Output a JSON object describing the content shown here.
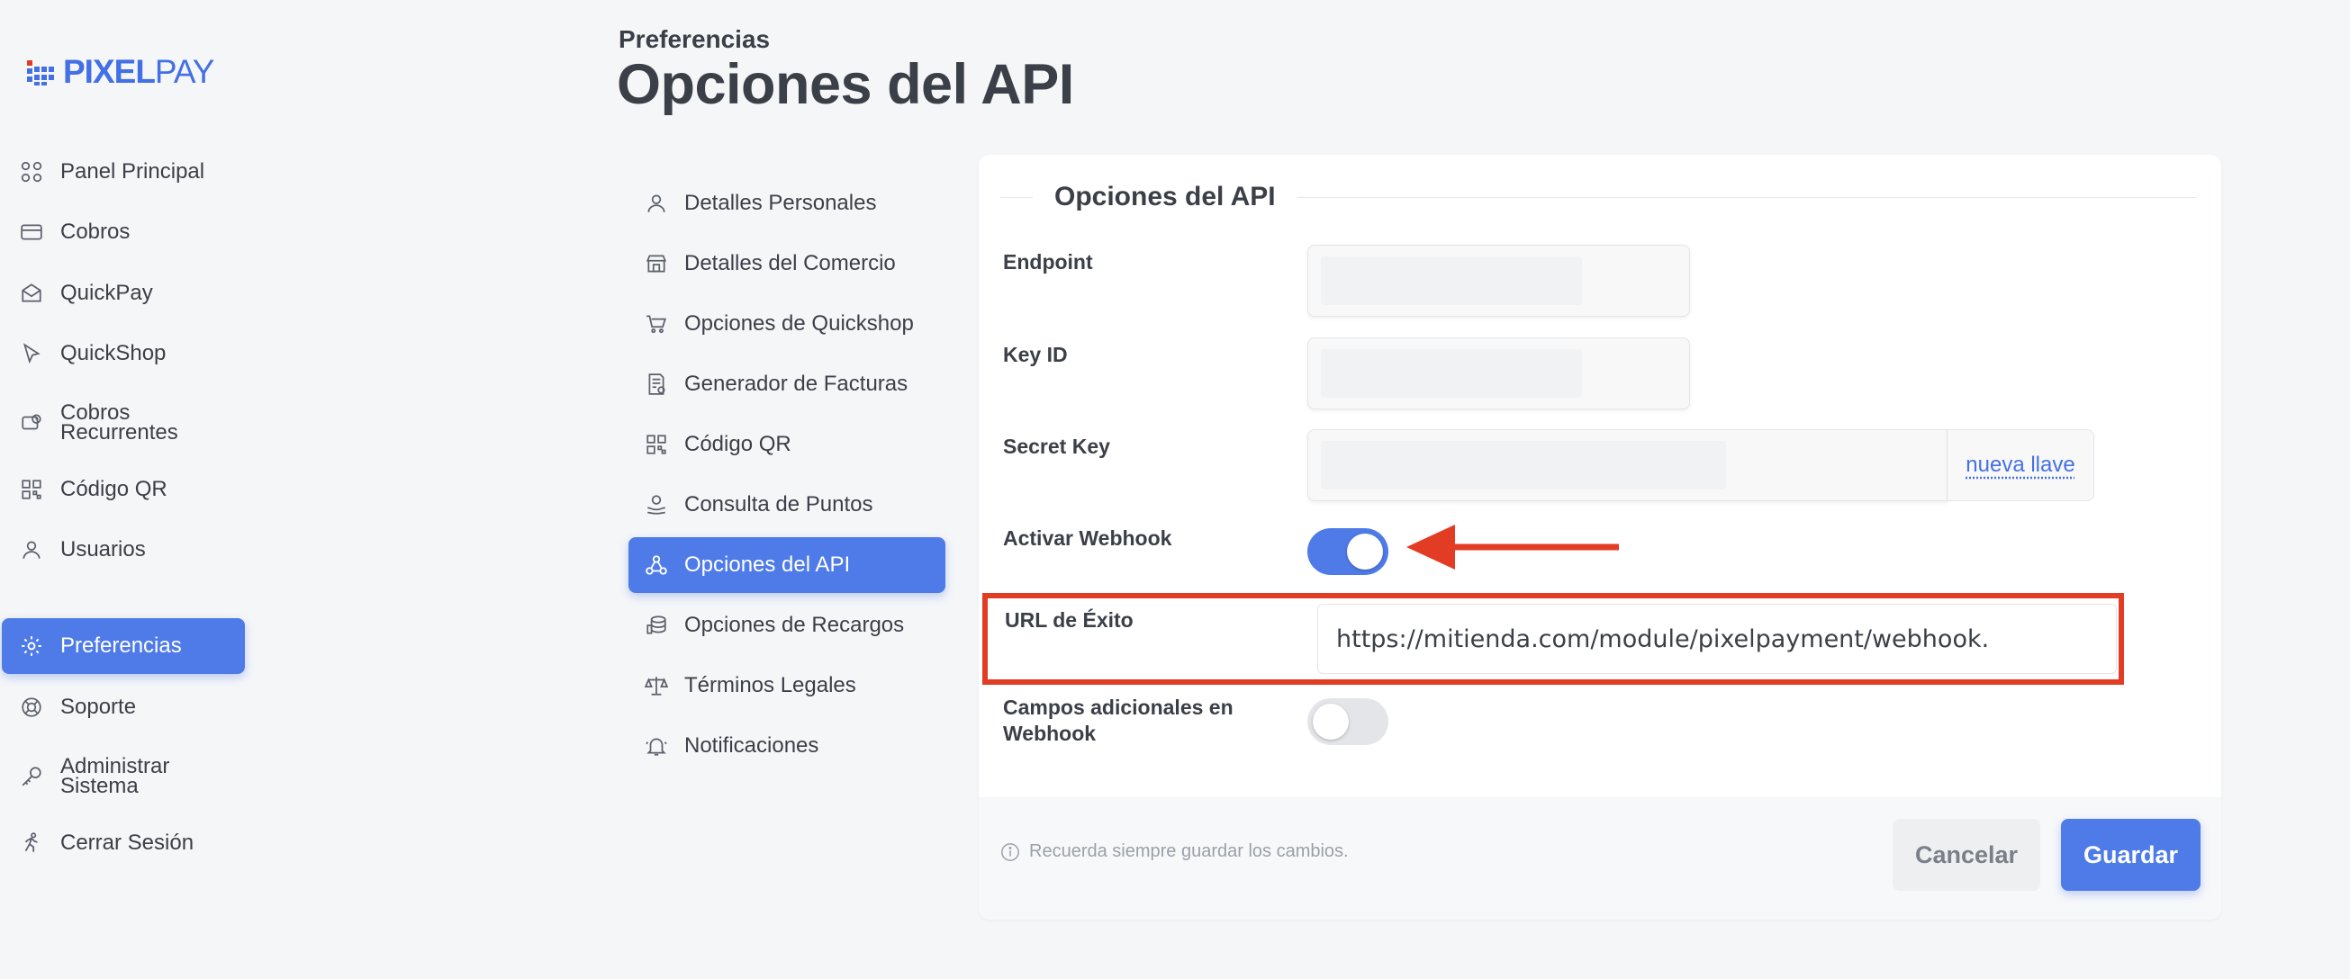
{
  "brand": {
    "name_bold": "PIXEL",
    "name_light": "PAY",
    "color": "#4470e6"
  },
  "sidebar": {
    "items": [
      {
        "label": "Panel Principal",
        "icon": "grid-icon"
      },
      {
        "label": "Cobros",
        "icon": "credit-card-icon"
      },
      {
        "label": "QuickPay",
        "icon": "envelope-icon"
      },
      {
        "label": "QuickShop",
        "icon": "cursor-icon"
      },
      {
        "label": "Cobros Recurrentes",
        "icon": "recurring-icon"
      },
      {
        "label": "Código QR",
        "icon": "qr-code-icon"
      },
      {
        "label": "Usuarios",
        "icon": "user-icon"
      },
      {
        "label": "Preferencias",
        "icon": "gear-icon",
        "active": true
      },
      {
        "label": "Soporte",
        "icon": "support-icon"
      },
      {
        "label": "Administrar Sistema",
        "icon": "key-icon"
      },
      {
        "label": "Cerrar Sesión",
        "icon": "logout-runner-icon"
      }
    ]
  },
  "header": {
    "breadcrumb": "Preferencias",
    "title": "Opciones del API"
  },
  "submenu": {
    "items": [
      {
        "label": "Detalles Personales",
        "icon": "user-icon"
      },
      {
        "label": "Detalles del Comercio",
        "icon": "store-icon"
      },
      {
        "label": "Opciones de Quickshop",
        "icon": "cart-icon"
      },
      {
        "label": "Generador de Facturas",
        "icon": "invoice-icon"
      },
      {
        "label": "Código QR",
        "icon": "qr-code-icon"
      },
      {
        "label": "Consulta de Puntos",
        "icon": "points-icon"
      },
      {
        "label": "Opciones del API",
        "icon": "webhook-icon",
        "active": true
      },
      {
        "label": "Opciones de Recargos",
        "icon": "coins-icon"
      },
      {
        "label": "Términos Legales",
        "icon": "scale-icon"
      },
      {
        "label": "Notificaciones",
        "icon": "bell-icon"
      }
    ]
  },
  "form": {
    "section_title": "Opciones del API",
    "endpoint_label": "Endpoint",
    "key_id_label": "Key ID",
    "secret_key_label": "Secret Key",
    "secret_key_action": "nueva llave",
    "webhook_label": "Activar Webhook",
    "webhook_enabled": true,
    "success_url_label": "URL de Éxito",
    "success_url_value": "https://mitienda.com/module/pixelpayment/webhook.",
    "extra_fields_label": "Campos adicionales en Webhook",
    "extra_fields_enabled": false
  },
  "footer": {
    "hint": "Recuerda siempre guardar los cambios.",
    "cancel_label": "Cancelar",
    "save_label": "Guardar"
  },
  "colors": {
    "accent": "#4e7be8",
    "annotation": "#e23c25"
  }
}
